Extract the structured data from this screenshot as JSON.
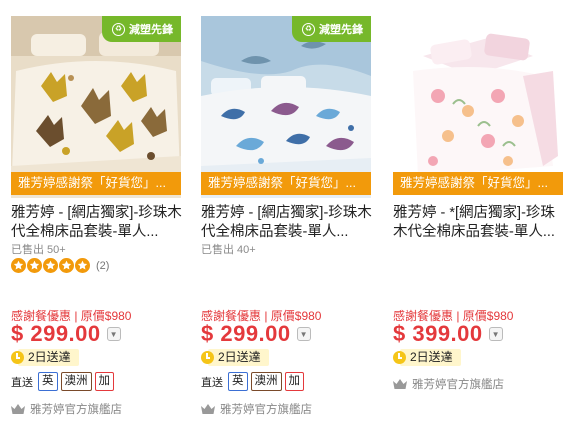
{
  "products": [
    {
      "eco_badge": "減塑先鋒",
      "promo_banner": "雅芳婷感謝祭「好貨您」...",
      "title": "雅芳婷 - [網店獨家]-珍珠木代全棉床品套裝-單人...",
      "sold": "已售出 50+",
      "rating_count": "(2)",
      "rating_stars": 5,
      "price_label": "感謝餐優惠 | 原價$980",
      "price": "$ 299.00",
      "delivery": "2日送達",
      "direct_label": "直送",
      "direct_tags": [
        "英",
        "澳洲",
        "加"
      ],
      "store": "雅芳婷官方旗艦店"
    },
    {
      "eco_badge": "減塑先鋒",
      "promo_banner": "雅芳婷感謝祭「好貨您」...",
      "title": "雅芳婷 - [網店獨家]-珍珠木代全棉床品套裝-單人...",
      "sold": "已售出 40+",
      "price_label": "感謝餐優惠 | 原價$980",
      "price": "$ 299.00",
      "delivery": "2日送達",
      "direct_label": "直送",
      "direct_tags": [
        "英",
        "澳洲",
        "加"
      ],
      "store": "雅芳婷官方旗艦店"
    },
    {
      "promo_banner": "雅芳婷感謝祭「好貨您」...",
      "title": "雅芳婷 - *[網店獨家]-珍珠木代全棉床品套裝-單人...",
      "price_label": "感謝餐優惠 | 原價$980",
      "price": "$ 399.00",
      "delivery": "2日送達",
      "store": "雅芳婷官方旗艦店"
    }
  ],
  "colors": {
    "price_red": "#e4393c",
    "promo_orange": "#f29a0b",
    "eco_green": "#76b82a",
    "star_orange": "#f29a0b"
  }
}
